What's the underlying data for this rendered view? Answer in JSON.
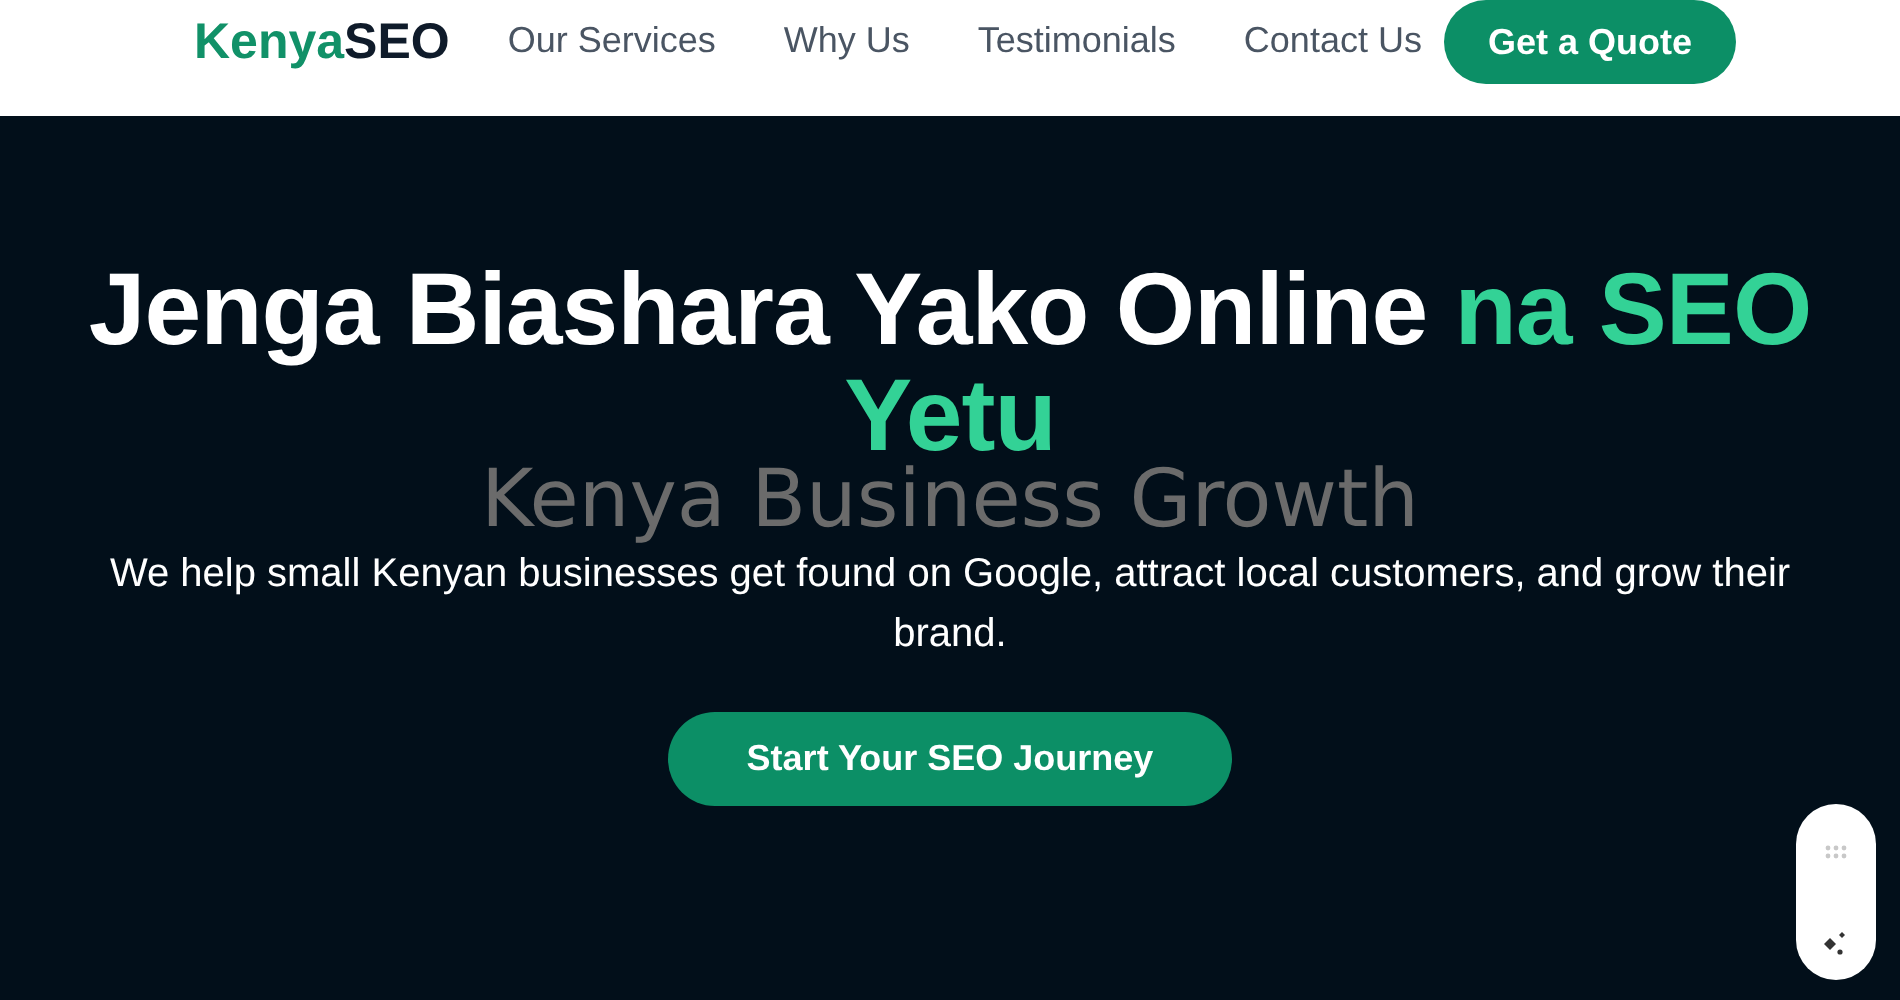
{
  "nav": {
    "logo": {
      "part1": "Kenya",
      "part2": "SEO"
    },
    "links": [
      "Our Services",
      "Why Us",
      "Testimonials",
      "Contact Us"
    ],
    "cta": "Get a Quote"
  },
  "hero": {
    "heading": "Jenga Biashara Yako Online",
    "heading_accent": "na SEO Yetu",
    "image_alt": "Kenya Business Growth",
    "text": "We help small Kenyan businesses get found on Google, attract local customers, and grow their brand.",
    "button": "Start Your SEO Journey"
  }
}
